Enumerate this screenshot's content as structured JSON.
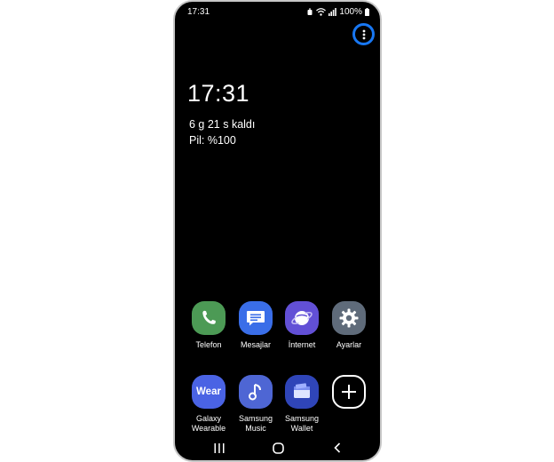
{
  "status_bar": {
    "time": "17:31",
    "battery_text": "100%"
  },
  "lock_screen": {
    "clock": "17:31",
    "remaining": "6 g 21 s kaldı",
    "battery": "Pil: %100"
  },
  "colors": {
    "highlight_ring": "#1877f2",
    "telefon": "#4c9a55",
    "mesajlar": "#3a6ee8",
    "internet": "#6250d6",
    "ayarlar": "#5f6b7a",
    "wear": "#4a63e4",
    "music": "#4e66d4",
    "wallet": "#2f45b8"
  },
  "apps_row1": [
    {
      "label": "Telefon",
      "icon": "phone-icon"
    },
    {
      "label": "Mesajlar",
      "icon": "messages-icon"
    },
    {
      "label": "İnternet",
      "icon": "internet-icon"
    },
    {
      "label": "Ayarlar",
      "icon": "settings-icon"
    }
  ],
  "apps_row2": [
    {
      "label": "Galaxy\nWearable",
      "icon": "wear-icon",
      "icon_text": "Wear"
    },
    {
      "label": "Samsung\nMusic",
      "icon": "music-icon"
    },
    {
      "label": "Samsung\nWallet",
      "icon": "wallet-icon"
    },
    {
      "label": "",
      "icon": "add-icon"
    }
  ]
}
